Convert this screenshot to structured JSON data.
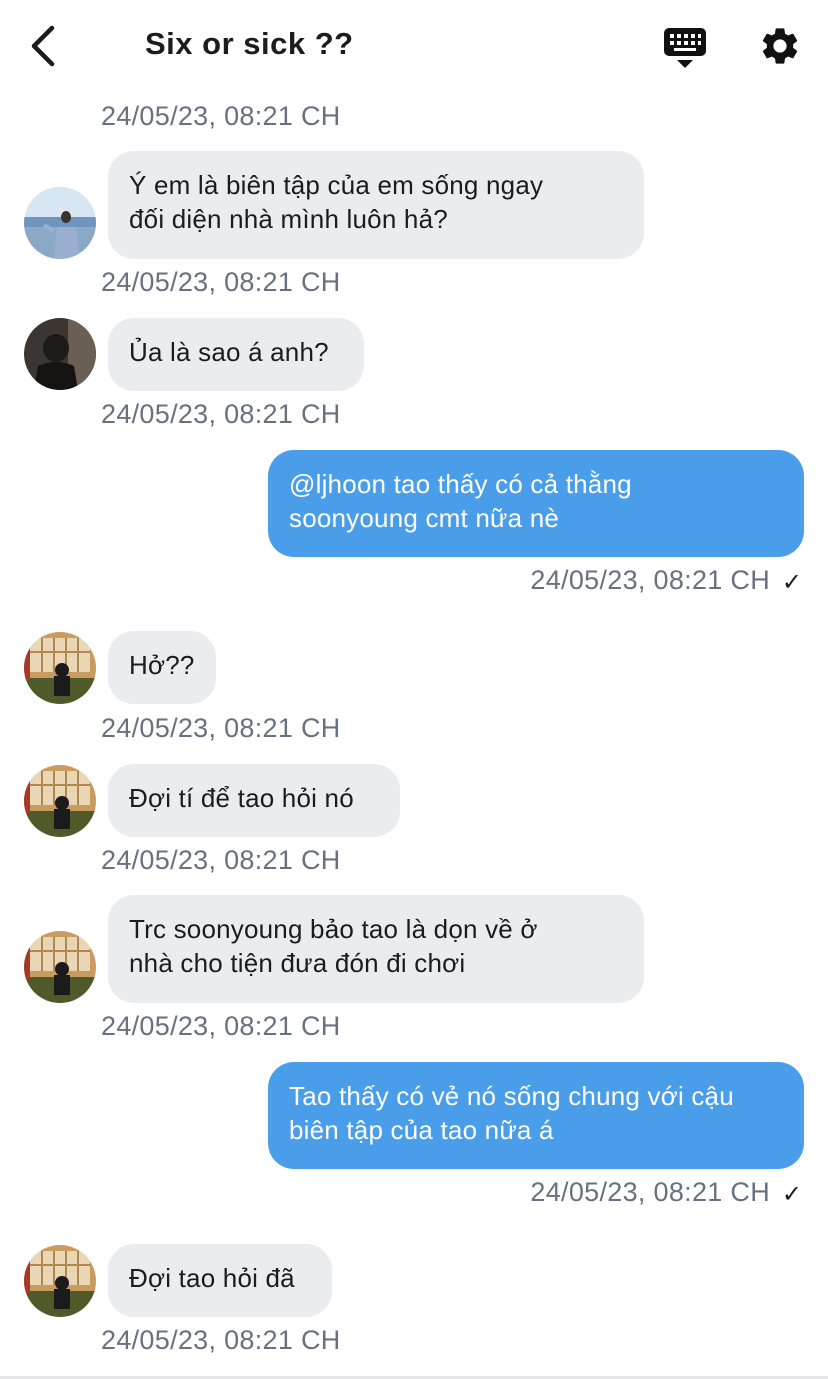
{
  "header": {
    "title": "Six or sick ??",
    "back_icon": "chevron-left-icon",
    "keyboard_icon": "keyboard-icon",
    "settings_icon": "gear-icon"
  },
  "colors": {
    "outgoing_bubble": "#4a9ee9",
    "incoming_bubble": "#eaecef",
    "timestamp": "#687180"
  },
  "messages": [
    {
      "direction": "system",
      "timestamp": "24/05/23, 08:21 CH"
    },
    {
      "direction": "in",
      "avatar": "avatar-1",
      "lines": [
        "Ý em là biên tập của em sống ngay",
        "đối diện nhà mình luôn hả?"
      ],
      "timestamp": "24/05/23, 08:21 CH"
    },
    {
      "direction": "in",
      "avatar": "avatar-2",
      "lines": [
        "Ủa là sao á anh?"
      ],
      "timestamp": "24/05/23, 08:21 CH"
    },
    {
      "direction": "out",
      "lines": [
        "@ljhoon tao thấy có cả thằng",
        "soonyoung cmt nữa nè"
      ],
      "timestamp": "24/05/23, 08:21 CH",
      "status": "✓"
    },
    {
      "direction": "in",
      "avatar": "avatar-3",
      "lines": [
        "Hở??"
      ],
      "timestamp": "24/05/23, 08:21 CH"
    },
    {
      "direction": "in",
      "avatar": "avatar-3",
      "lines": [
        "Đợi tí để tao hỏi nó"
      ],
      "timestamp": "24/05/23, 08:21 CH"
    },
    {
      "direction": "in",
      "avatar": "avatar-3",
      "lines": [
        "Trc soonyoung bảo tao là dọn về ở",
        "nhà cho tiện đưa đón đi chơi"
      ],
      "timestamp": "24/05/23, 08:21 CH"
    },
    {
      "direction": "out",
      "lines": [
        "Tao thấy có vẻ nó sống chung với cậu",
        "biên tập của tao nữa á"
      ],
      "timestamp": "24/05/23, 08:21 CH",
      "status": "✓"
    },
    {
      "direction": "in",
      "avatar": "avatar-3",
      "lines": [
        "Đợi tao hỏi đã"
      ],
      "timestamp": "24/05/23, 08:21 CH"
    }
  ]
}
